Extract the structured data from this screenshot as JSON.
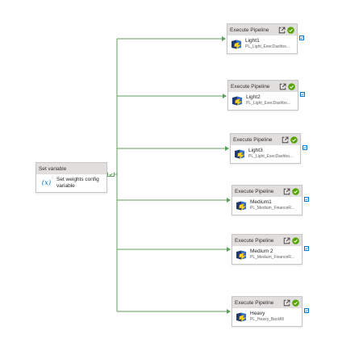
{
  "set_variable": {
    "type": "Set variable",
    "name": "Set weights config variable",
    "icon": "variable-icon"
  },
  "pipelines": [
    {
      "type": "Execute Pipeline",
      "name": "Light1",
      "sub": "PL_Light_ExecDashbo..."
    },
    {
      "type": "Execute Pipeline",
      "name": "Light2",
      "sub": "PL_Light_ExecDashbo..."
    },
    {
      "type": "Execute Pipeline",
      "name": "Light3",
      "sub": "PL_Light_ExecDashbo..."
    },
    {
      "type": "Execute Pipeline",
      "name": "Medium1",
      "sub": "PL_Medium_FinanceR..."
    },
    {
      "type": "Execute Pipeline",
      "name": "Medium 2",
      "sub": "PL_Medium_FinanceR..."
    },
    {
      "type": "Execute Pipeline",
      "name": "Heavy",
      "sub": "PL_Heavy_Backfill"
    }
  ],
  "colors": {
    "connector": "#5c9e5c",
    "success": "#57a300",
    "accent": "#0078d4"
  },
  "icons": {
    "open": "open-in-new-icon",
    "status": "success-check-icon",
    "pipeline": "execute-pipeline-icon"
  }
}
